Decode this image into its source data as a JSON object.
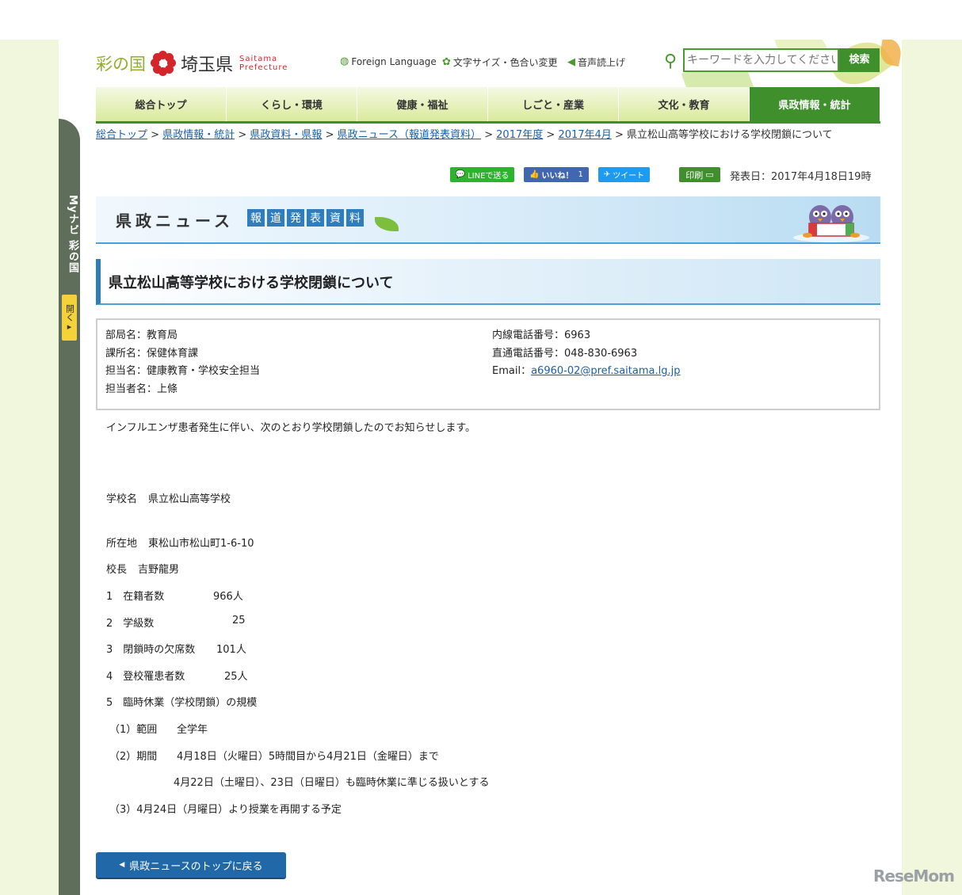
{
  "header": {
    "logo_sainokuni": "彩の国",
    "logo_saitama": "埼玉県",
    "logo_en_1": "Saitama",
    "logo_en_2": "Prefecture",
    "foreign_language": "Foreign Language",
    "font_size_color": "文字サイズ・色合い変更",
    "voice_reading": "音声読上げ",
    "search_placeholder": "キーワードを入力してください",
    "search_button": "検索"
  },
  "nav": {
    "items": [
      "総合トップ",
      "くらし・環境",
      "健康・福祉",
      "しごと・産業",
      "文化・教育",
      "県政情報・統計"
    ],
    "active_index": 5
  },
  "breadcrumb": {
    "links": [
      "総合トップ",
      "県政情報・統計",
      "県政資料・県報",
      "県政ニュース（報道発表資料）",
      "2017年度",
      "2017年4月"
    ],
    "separator": ">",
    "current": "県立松山高等学校における学校閉鎖について"
  },
  "social": {
    "line": "LINEで送る",
    "like": "いいね！",
    "like_count": "1",
    "tweet": "ツイート",
    "print": "印刷"
  },
  "publish_date": "発表日：2017年4月18日19時",
  "banner": {
    "title": "県政ニュース",
    "kana": [
      "報",
      "道",
      "発",
      "表",
      "資",
      "料"
    ]
  },
  "page_title": "県立松山高等学校における学校閉鎖について",
  "info": {
    "bureau": "部局名：教育局",
    "section": "課所名：保健体育課",
    "charge": "担当名：健康教育・学校安全担当",
    "person": "担当者名：上條",
    "ext_phone": "内線電話番号：6963",
    "direct_phone": "直通電話番号：048-830-6963",
    "email_label": "Email：",
    "email": "a6960-02@pref.saitama.lg.jp"
  },
  "body": {
    "intro": "インフルエンザ患者発生に伴い、次のとおり学校閉鎖したのでお知らせします。",
    "school_label": "学校名",
    "school_name": "県立松山高等学校",
    "address_label": "所在地",
    "address": "東松山市松山町1-6-10",
    "principal_label": "校長",
    "principal": "吉野龍男",
    "item1_label": "1　在籍者数",
    "item1_value": "966人",
    "item2_label": "2　学級数",
    "item2_value": "25",
    "item3_label": "3　閉鎖時の欠席数",
    "item3_value": "101人",
    "item4_label": "4　登校罹患者数",
    "item4_value": "25人",
    "item5": "5　臨時休業（学校閉鎖）の規模",
    "sub1_label": "（1）範囲",
    "sub1_value": "全学年",
    "sub2_label": "（2）期間",
    "sub2_value": "4月18日（火曜日）5時間目から4月21日（金曜日）まで",
    "sub2_note": "4月22日（土曜日）、23日（日曜日）も臨時休業に準じる扱いとする",
    "sub3": "（3）4月24日（月曜日）より授業を再開する予定"
  },
  "sidebar": {
    "mynavi": "Myナビ 彩の国",
    "open": "開く"
  },
  "back_button": "県政ニュースのトップに戻る",
  "watermark": "ReseMom",
  "colors": {
    "green": "#3f8f2c",
    "blue": "#2f7dbd",
    "link": "#1a5fa8"
  }
}
